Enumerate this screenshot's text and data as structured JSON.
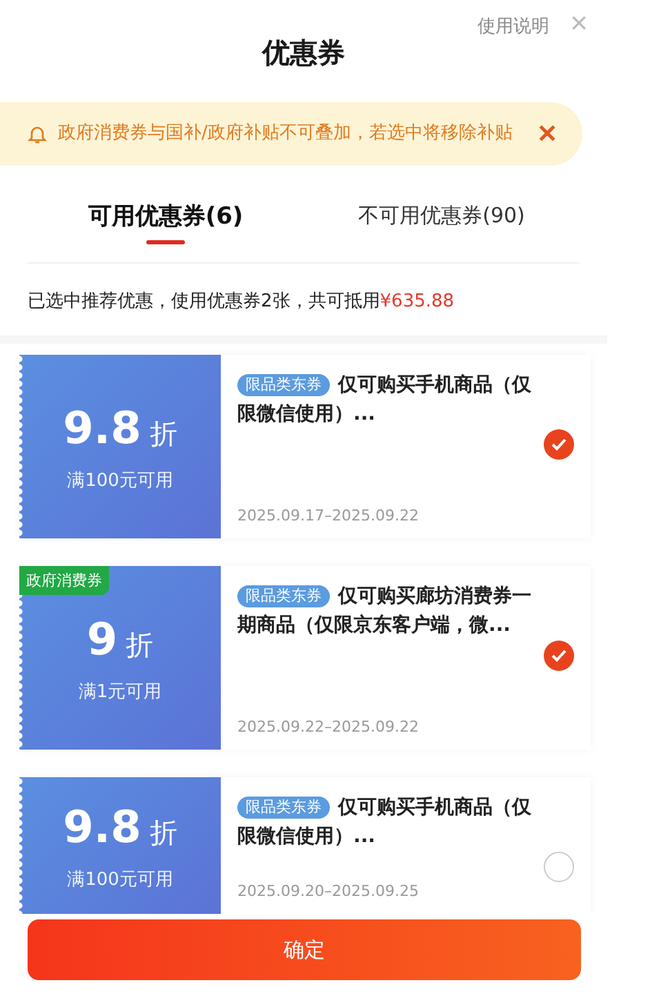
{
  "header": {
    "title": "优惠券",
    "help_link": "使用说明",
    "close": "×"
  },
  "notice": {
    "text": "政府消费券与国补/政府补贴不可叠加，若选中将移除补贴",
    "dismiss": "✕"
  },
  "tabs": [
    {
      "label": "可用优惠券(6)",
      "selected": true
    },
    {
      "label": "不可用优惠券(90)",
      "selected": false
    }
  ],
  "summary": {
    "text": "已选中推荐优惠，使用优惠券2张，共可抵用",
    "amount": "¥635.88"
  },
  "coupons": [
    {
      "value": "9.8",
      "unit": "折",
      "condition": "满100元可用",
      "tag": "限品类东券",
      "title": "仅可购买手机商品（仅限微信使用）...",
      "dates": "2025.09.17–2025.09.22",
      "selected": true
    },
    {
      "corner_badge": "政府消费券",
      "value": "9",
      "unit": "折",
      "condition": "满1元可用",
      "tag": "限品类东券",
      "title": "仅可购买廊坊消费券一期商品（仅限京东客户端，微...",
      "dates": "2025.09.22–2025.09.22",
      "selected": true
    },
    {
      "value": "9.8",
      "unit": "折",
      "condition": "满100元可用",
      "tag": "限品类东券",
      "title": "仅可购买手机商品（仅限微信使用）...",
      "dates": "2025.09.20–2025.09.25",
      "selected": false
    }
  ],
  "confirm_button": "确定"
}
